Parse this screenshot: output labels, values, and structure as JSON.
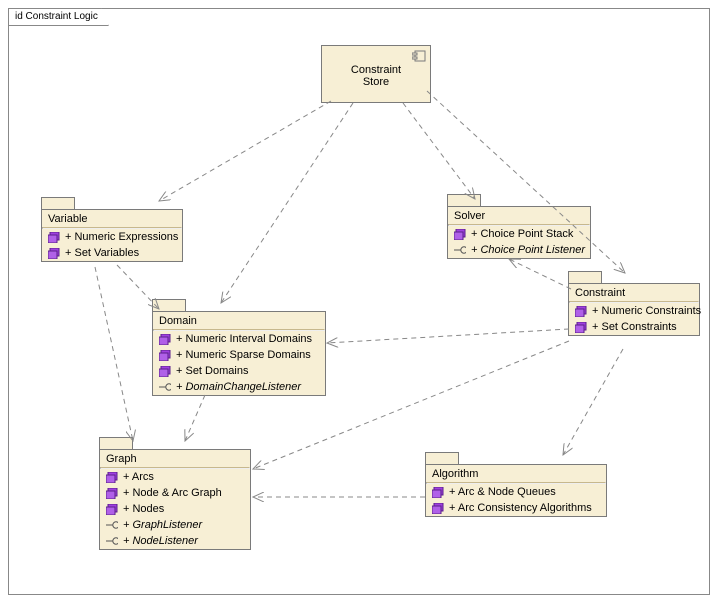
{
  "frame": {
    "title": "id Constraint Logic"
  },
  "component": {
    "title": "Constraint Store"
  },
  "packages": {
    "variable": {
      "title": "Variable",
      "items": [
        {
          "label": "+ Numeric Expressions",
          "kind": "module"
        },
        {
          "label": "+ Set Variables",
          "kind": "module"
        }
      ]
    },
    "domain": {
      "title": "Domain",
      "items": [
        {
          "label": "+ Numeric Interval Domains",
          "kind": "module"
        },
        {
          "label": "+ Numeric Sparse Domains",
          "kind": "module"
        },
        {
          "label": "+ Set Domains",
          "kind": "module"
        },
        {
          "label": "+ DomainChangeListener",
          "kind": "interface",
          "italic": true
        }
      ]
    },
    "solver": {
      "title": "Solver",
      "items": [
        {
          "label": "+ Choice Point Stack",
          "kind": "module"
        },
        {
          "label": "+ Choice Point Listener",
          "kind": "interface",
          "italic": true
        }
      ]
    },
    "constraint": {
      "title": "Constraint",
      "items": [
        {
          "label": "+ Numeric Constraints",
          "kind": "module"
        },
        {
          "label": "+ Set Constraints",
          "kind": "module"
        }
      ]
    },
    "graph": {
      "title": "Graph",
      "items": [
        {
          "label": "+ Arcs",
          "kind": "module"
        },
        {
          "label": "+ Node & Arc Graph",
          "kind": "module"
        },
        {
          "label": "+ Nodes",
          "kind": "module"
        },
        {
          "label": "+ GraphListener",
          "kind": "interface",
          "italic": true
        },
        {
          "label": "+ NodeListener",
          "kind": "interface",
          "italic": true
        }
      ]
    },
    "algorithm": {
      "title": "Algorithm",
      "items": [
        {
          "label": "+ Arc & Node Queues",
          "kind": "module"
        },
        {
          "label": "+ Arc Consistency Algorithms",
          "kind": "module"
        }
      ]
    }
  },
  "dependencies": [
    {
      "from": "constraint_store",
      "to": "variable"
    },
    {
      "from": "constraint_store",
      "to": "domain"
    },
    {
      "from": "constraint_store",
      "to": "solver"
    },
    {
      "from": "constraint_store",
      "to": "constraint"
    },
    {
      "from": "variable",
      "to": "domain"
    },
    {
      "from": "variable",
      "to": "graph"
    },
    {
      "from": "domain",
      "to": "graph"
    },
    {
      "from": "constraint",
      "to": "solver"
    },
    {
      "from": "constraint",
      "to": "domain"
    },
    {
      "from": "constraint",
      "to": "graph"
    },
    {
      "from": "constraint",
      "to": "algorithm"
    },
    {
      "from": "algorithm",
      "to": "graph"
    }
  ]
}
